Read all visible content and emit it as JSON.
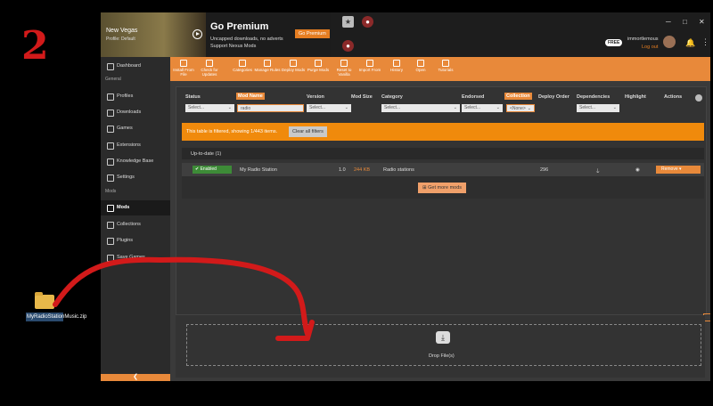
{
  "step_number": "2",
  "desktop_file": {
    "name": "MyRadioStationMusic.zip"
  },
  "header": {
    "game_name": "New Vegas",
    "profile": "Profile: Default",
    "premium_title": "Go Premium",
    "premium_lines": [
      "Uncapped downloads, no adverts",
      "Support Nexus Mods"
    ],
    "premium_button": "Go Premium",
    "free_badge": "FREE",
    "username": "immortlemous",
    "logout": "Log out"
  },
  "toolbar": [
    "Install From File",
    "Check for Updates",
    "Categories",
    "Manage Rules",
    "Deploy Mods",
    "Purge Mods",
    "Reset to Vanilla",
    "Import From",
    "History",
    "Open",
    "Tutorials"
  ],
  "sidebar": {
    "dashboard": "Dashboard",
    "general_header": "General",
    "general": [
      "Profiles",
      "Downloads",
      "Games",
      "Extensions",
      "Knowledge Base",
      "Settings"
    ],
    "mods_header": "Mods",
    "mods": [
      "Mods",
      "Collections",
      "Plugins",
      "Save Games"
    ],
    "collapse_glyph": "❮"
  },
  "table": {
    "columns": {
      "status": "Status",
      "mod_name": "Mod Name",
      "version": "Version",
      "mod_size": "Mod Size",
      "category": "Category",
      "endorsed": "Endorsed",
      "collection": "Collection",
      "deploy_order": "Deploy Order",
      "dependencies": "Dependencies",
      "highlight": "Highlight",
      "actions": "Actions"
    },
    "filters": {
      "status": "Select...",
      "mod_name": "radio",
      "version": "Select...",
      "category": "Select...",
      "endorsed": "Select...",
      "collection": "<None>",
      "dependencies": "Select..."
    },
    "filter_banner": "This table is filtered, showing 1/443 items.",
    "clear_filters": "Clear all filters",
    "group_label": "Up-to-date (1)",
    "row": {
      "status": "Enabled",
      "name": "My Radio Station",
      "version": "1.0",
      "size": "244 KB",
      "category": "Radio stations",
      "deploy_order": "296",
      "action": "Remove"
    },
    "get_more_mods": "Get more mods"
  },
  "drop_zone": {
    "label": "Drop File(s)"
  },
  "colors": {
    "accent": "#e8893a",
    "enabled": "#3d8b37",
    "annotation": "#d21a1a"
  }
}
